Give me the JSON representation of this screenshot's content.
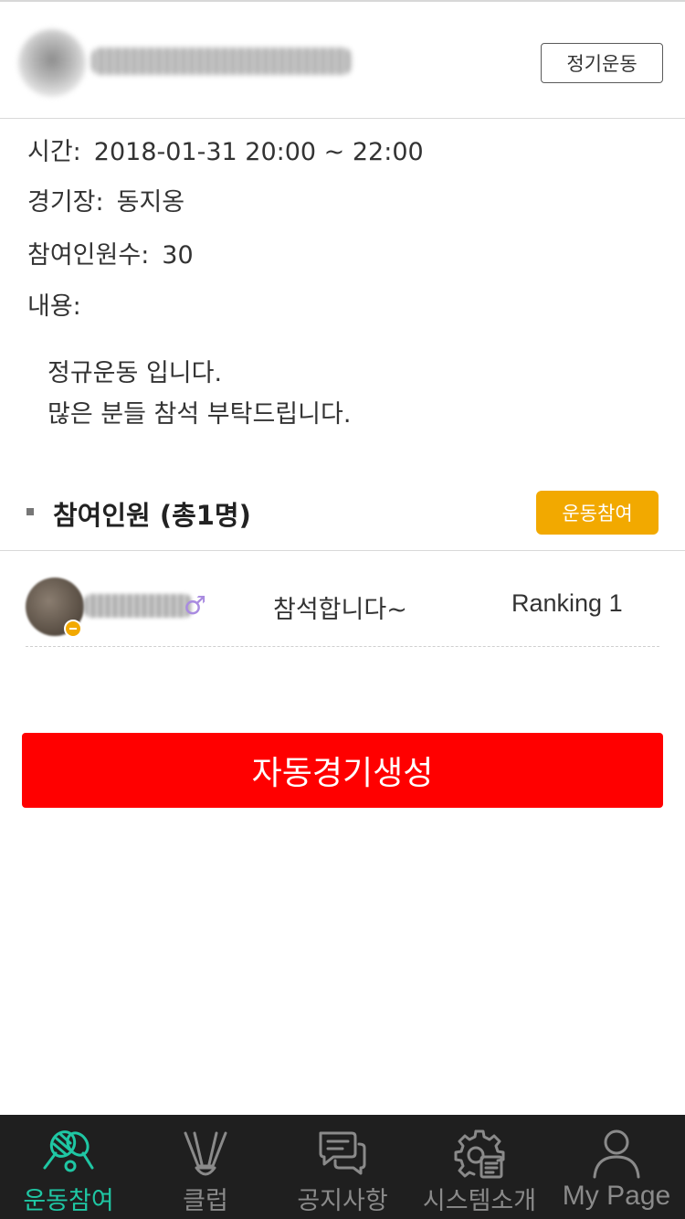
{
  "header": {
    "type_badge": "정기운동"
  },
  "info": {
    "time_label": "시간:",
    "time_value": "2018-01-31 20:00 ~ 22:00",
    "venue_label": "경기장:",
    "venue_value": "동지옹",
    "count_label": "참여인원수:",
    "count_value": "30",
    "content_label": "내용:",
    "content_lines": [
      "정규운동 입니다.",
      "많은 분들 참석 부탁드립니다."
    ]
  },
  "participants_section": {
    "title": "참여인원 (총1명)",
    "join_button": "운동참여",
    "rows": [
      {
        "gender_symbol": "♂",
        "comment": "참석합니다~",
        "ranking": "Ranking 1"
      }
    ]
  },
  "auto_match_button": "자동경기생성",
  "bottom_nav": {
    "items": [
      {
        "label": "운동참여",
        "icon": "badminton-icon",
        "active": true
      },
      {
        "label": "클럽",
        "icon": "shuttlecock-icon",
        "active": false
      },
      {
        "label": "공지사항",
        "icon": "chat-bubbles-icon",
        "active": false
      },
      {
        "label": "시스템소개",
        "icon": "gear-document-icon",
        "active": false
      },
      {
        "label": "My Page",
        "icon": "user-icon",
        "active": false
      }
    ]
  },
  "colors": {
    "accent_teal": "#1fc7a4",
    "join_orange": "#f2a900",
    "action_red": "#ff0000",
    "nav_background": "#1f1f1f",
    "gender_male": "#a98be0"
  }
}
